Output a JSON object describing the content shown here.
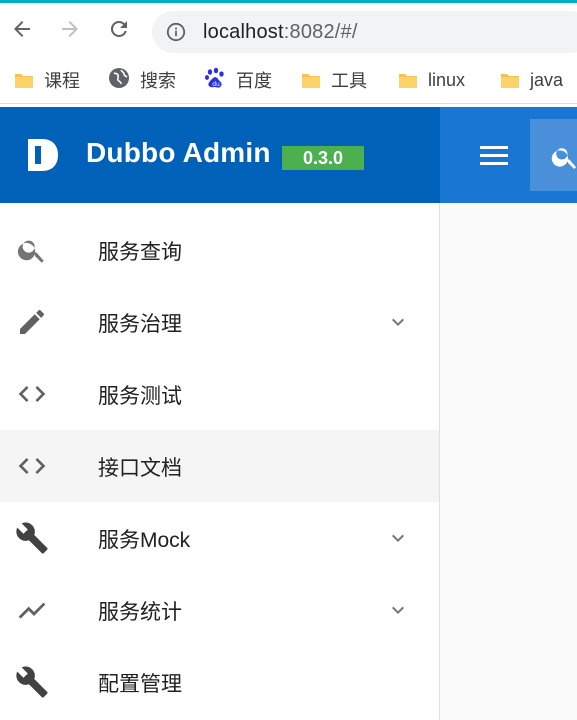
{
  "browser": {
    "url_host": "localhost",
    "url_rest": ":8082/#/",
    "icons": {
      "back": "arrow-left-icon",
      "forward": "arrow-right-icon",
      "reload": "reload-icon",
      "info": "info-icon"
    }
  },
  "bookmarks": [
    {
      "label": "课程",
      "icon": "folder-icon"
    },
    {
      "label": "搜索",
      "icon": "globe-icon"
    },
    {
      "label": "百度",
      "icon": "baidu-paw-icon"
    },
    {
      "label": "工具",
      "icon": "folder-icon"
    },
    {
      "label": "linux",
      "icon": "folder-icon"
    },
    {
      "label": "java",
      "icon": "folder-icon"
    }
  ],
  "header": {
    "title": "Dubbo Admin",
    "version": "0.3.0",
    "colors": {
      "brand": "#0061b8",
      "bar": "#1976d2",
      "version_badge": "#4caf50"
    }
  },
  "sidebar": {
    "items": [
      {
        "label": "服务查询",
        "icon": "search-icon",
        "expandable": false,
        "active": false
      },
      {
        "label": "服务治理",
        "icon": "pencil-icon",
        "expandable": true,
        "active": false
      },
      {
        "label": "服务测试",
        "icon": "code-icon",
        "expandable": false,
        "active": false
      },
      {
        "label": "接口文档",
        "icon": "code-icon",
        "expandable": false,
        "active": true
      },
      {
        "label": "服务Mock",
        "icon": "wrench-icon",
        "expandable": true,
        "active": false
      },
      {
        "label": "服务统计",
        "icon": "trending-icon",
        "expandable": true,
        "active": false
      },
      {
        "label": "配置管理",
        "icon": "wrench-icon",
        "expandable": false,
        "active": false
      }
    ]
  }
}
